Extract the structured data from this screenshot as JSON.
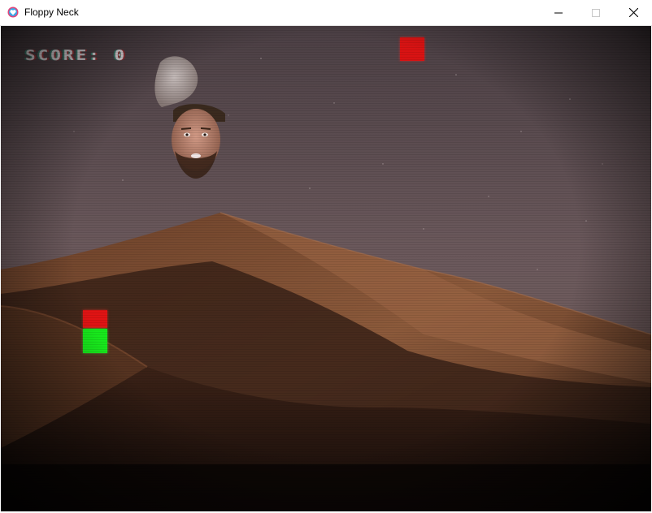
{
  "window": {
    "title": "Floppy Neck",
    "accent": "#e0447a"
  },
  "hud": {
    "score_label": "SCORE:",
    "score_value": "0"
  },
  "colors": {
    "sky": "#6f5c60",
    "dune_light": "#8a5a3c",
    "dune_shadow": "#231510",
    "block_red": "#e01414",
    "block_green": "#18e81c"
  },
  "icons": {
    "app": "heart-icon",
    "minimize": "minimize-icon",
    "maximize": "maximize-icon",
    "close": "close-icon"
  }
}
